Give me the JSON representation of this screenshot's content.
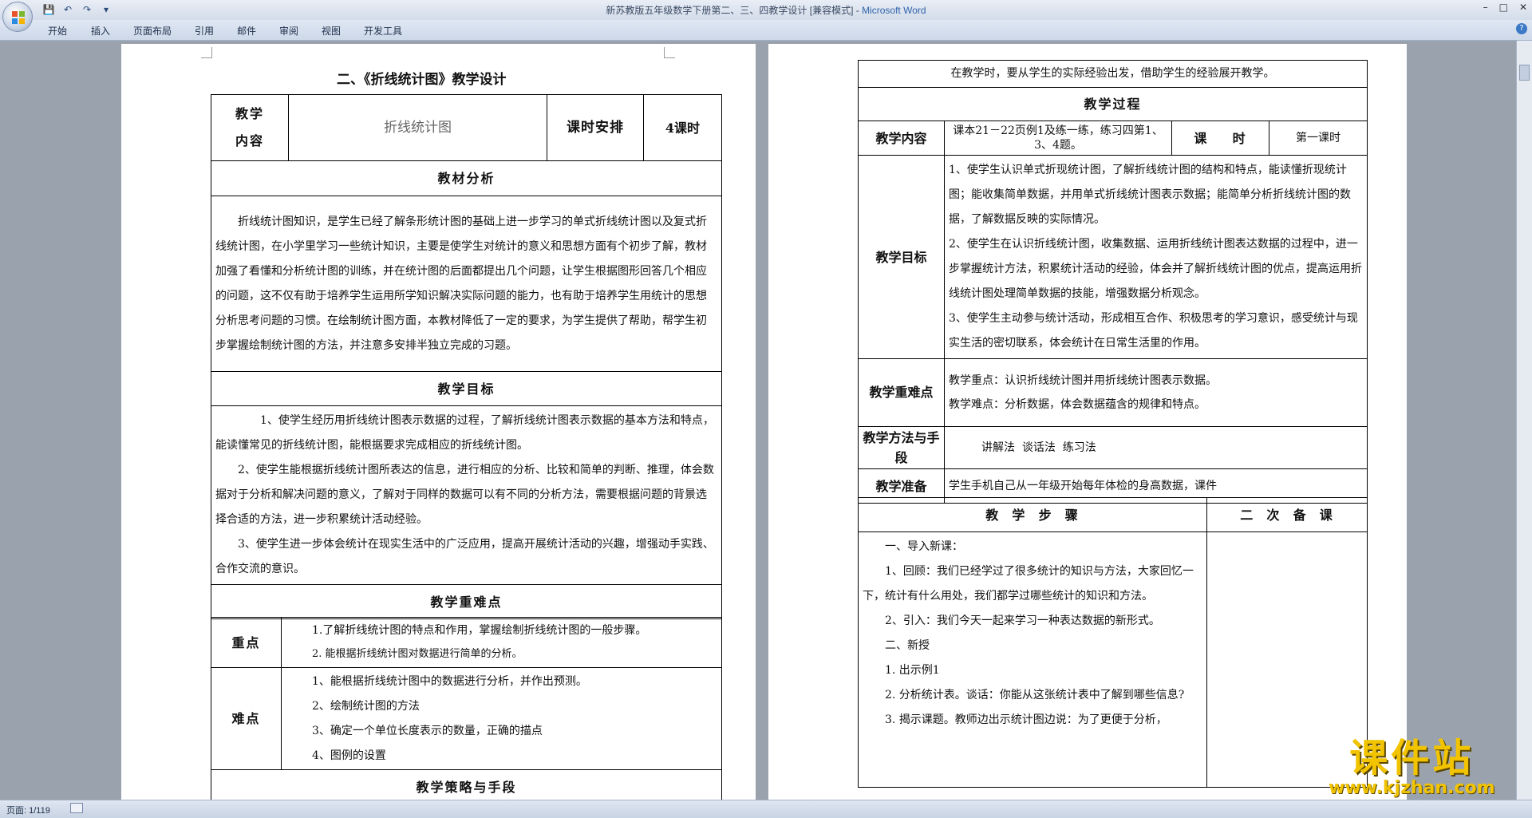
{
  "window": {
    "title": "新苏教版五年级数学下册第二、三、四教学设计 [兼容模式] - ",
    "app_name": "Microsoft Word"
  },
  "quick_access": {
    "save": "💾",
    "undo": "↶",
    "redo": "↷",
    "customize": "▾"
  },
  "ribbon": {
    "tabs": [
      "开始",
      "插入",
      "页面布局",
      "引用",
      "邮件",
      "审阅",
      "视图",
      "开发工具"
    ]
  },
  "left_page": {
    "title": "二、《折线统计图》教学设计",
    "row1": {
      "label": "教学\n内容",
      "content": "折线统计图",
      "schedule_label": "课时安排",
      "schedule_value": "4课时"
    },
    "analysis_heading": "教材分析",
    "analysis_text": "折线统计图知识，是学生已经了解条形统计图的基础上进一步学习的单式折线统计图以及复式折线统计图，在小学里学习一些统计知识，主要是使学生对统计的意义和思想方面有个初步了解，教材加强了看懂和分析统计图的训练，并在统计图的后面都提出几个问题，让学生根据图形回答几个相应的问题，这不仅有助于培养学生运用所学知识解决实际问题的能力，也有助于培养学生用统计的思想分析思考问题的习惯。在绘制统计图方面，本教材降低了一定的要求，为学生提供了帮助，帮学生初步掌握绘制统计图的方法，并注意多安排半独立完成的习题。",
    "goals_heading": "教学目标",
    "goals": [
      "1、使学生经历用折线统计图表示数据的过程，了解折线统计图表示数据的基本方法和特点，能读懂常见的折线统计图，能根据要求完成相应的折线统计图。",
      "2、使学生能根据折线统计图所表达的信息，进行相应的分析、比较和简单的判断、推理，体会数据对于分析和解决问题的意义，了解对于同样的数据可以有不同的分析方法，需要根据问题的背景选择合适的方法，进一步积累统计活动经验。",
      "3、使学生进一步体会统计在现实生活中的广泛应用，提高开展统计活动的兴趣，增强动手实践、合作交流的意识。"
    ],
    "key_heading": "教学重难点",
    "key_label": "重点",
    "key_points": [
      "1.了解折线统计图的特点和作用，掌握绘制折线统计图的一般步骤。",
      "2.  能根据折线统计图对数据进行简单的分析。"
    ],
    "diff_label": "难点",
    "diff_points": [
      "1、能根据折线统计图中的数据进行分析，并作出预测。",
      "2、绘制统计图的方法",
      "3、确定一个单位长度表示的数量，正确的描点",
      "4、图例的设置"
    ],
    "strategy_heading": "教学策略与手段"
  },
  "right_page": {
    "top_text": "在教学时，要从学生的实际经验出发，借助学生的经验展开教学。",
    "process_heading": "教学过程",
    "content_label": "教学内容",
    "content_value": "课本21－22页例1及练一练，练习四第1、3、4题。",
    "period_label": "课    时",
    "period_value": "第一课时",
    "goal_label": "教学目标",
    "goals": [
      "1、使学生认识单式折现统计图，了解折线统计图的结构和特点，能读懂折现统计图；能收集简单数据，并用单式折线统计图表示数据；能简单分析折线统计图的数据，了解数据反映的实际情况。",
      "2、使学生在认识折线统计图，收集数据、运用折线统计图表达数据的过程中，进一步掌握统计方法，积累统计活动的经验，体会并了解折线统计图的优点，提高运用折线统计图处理简单数据的技能，增强数据分析观念。",
      "3、使学生主动参与统计活动，形成相互合作、积极思考的学习意识，感受统计与现实生活的密切联系，体会统计在日常生活里的作用。"
    ],
    "key_label": "教学重难点",
    "key_lines": [
      "教学重点：认识折线统计图并用折线统计图表示数据。",
      "教学难点：分析数据，体会数据蕴含的规律和特点。"
    ],
    "method_label": "教学方法与手段",
    "method_value": "讲解法  谈话法  练习法",
    "prep_label": "教学准备",
    "prep_value": "学生手机自己从一年级开始每年体检的身高数据，课件",
    "steps_heading": "教  学  步  骤",
    "second_heading": "二  次  备  课",
    "steps": [
      "一、导入新课：",
      "1、回顾：我们已经学过了很多统计的知识与方法，大家回忆一下，统计有什么用处，我们都学过哪些统计的知识和方法。",
      "2、引入：我们今天一起来学习一种表达数据的新形式。",
      "二、新授",
      "1. 出示例1",
      "2. 分析统计表。谈话：你能从这张统计表中了解到哪些信息?",
      "3. 揭示课题。教师边出示统计图边说：为了更便于分析，"
    ]
  },
  "status_bar": {
    "page": "页面: 1/119"
  },
  "watermark": {
    "text": "课件站",
    "url": "www.kjzhan.com"
  }
}
